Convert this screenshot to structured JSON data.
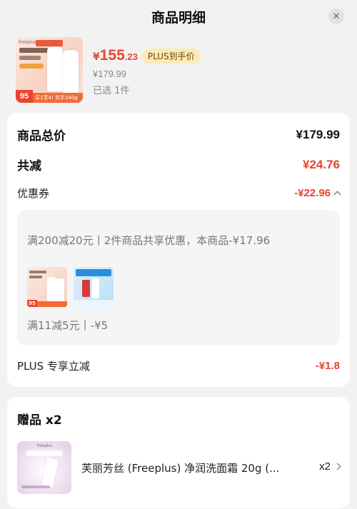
{
  "header": {
    "title": "商品明细",
    "close_icon": "close-icon"
  },
  "product": {
    "thumb_text": "88%氨基酸 国货优选",
    "thumb_badge_num": "95",
    "thumb_badge_text": "买1享4! 到手240g",
    "price_symbol": "¥",
    "price_main": "155",
    "price_decimal": ".23",
    "plus_badge": "PLUS到手价",
    "original_price": "¥179.99",
    "selected_count": "已选 1件"
  },
  "price_detail": {
    "total_label": "商品总价",
    "total_value": "¥179.99",
    "reduction_label": "共减",
    "reduction_value": "¥24.76",
    "coupon_label": "优惠券",
    "coupon_value": "-¥22.96",
    "coupon_toggle_icon": "chevron-up-icon",
    "coupons": [
      {
        "text": "满200减20元丨2件商品共享优惠，本商品-¥17.96"
      },
      {
        "text": "满11减5元丨-¥5"
      }
    ],
    "plus_label": "PLUS 专享立减",
    "plus_value": "-¥1.8"
  },
  "gifts": {
    "title": "赠品 x2",
    "items": [
      {
        "name": "芙丽芳丝 (Freeplus) 净润洗面霜 20g (...",
        "qty": "x2",
        "icon": "chevron-right-icon"
      }
    ]
  },
  "colors": {
    "accent_red": "#e8442f",
    "plus_badge_bg": "#fde9b4",
    "background": "#f2f2f2"
  }
}
